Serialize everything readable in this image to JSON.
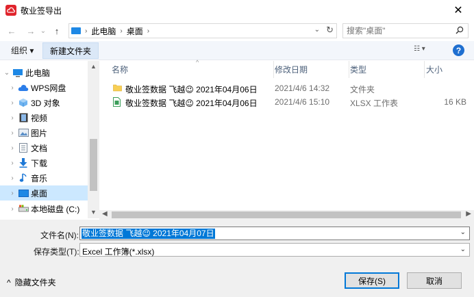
{
  "window": {
    "title": "敬业签导出",
    "close_glyph": "✕"
  },
  "nav": {
    "back_glyph": "←",
    "forward_glyph": "→",
    "history_glyph": "⌄",
    "up_glyph": "↑",
    "breadcrumb": [
      "此电脑",
      "桌面"
    ],
    "crumb_sep": "›",
    "dropdown_glyph": "⌄",
    "refresh_glyph": "↻",
    "search_placeholder": "搜索\"桌面\""
  },
  "toolbar": {
    "organize_label": "组织 ▾",
    "new_folder_label": "新建文件夹",
    "view_glyph": "☷ ▾",
    "help_glyph": "?"
  },
  "sidebar": {
    "items": [
      {
        "label": "此电脑",
        "icon": "computer-icon",
        "chev": "⌄",
        "indent": 0
      },
      {
        "label": "WPS网盘",
        "icon": "cloud-icon",
        "chev": "›",
        "indent": 1
      },
      {
        "label": "3D 对象",
        "icon": "cube-icon",
        "chev": "›",
        "indent": 1
      },
      {
        "label": "视频",
        "icon": "video-icon",
        "chev": "›",
        "indent": 1
      },
      {
        "label": "图片",
        "icon": "picture-icon",
        "chev": "›",
        "indent": 1
      },
      {
        "label": "文档",
        "icon": "document-icon",
        "chev": "›",
        "indent": 1
      },
      {
        "label": "下载",
        "icon": "download-icon",
        "chev": "›",
        "indent": 1
      },
      {
        "label": "音乐",
        "icon": "music-icon",
        "chev": "›",
        "indent": 1
      },
      {
        "label": "桌面",
        "icon": "desktop-icon",
        "chev": "›",
        "indent": 1,
        "selected": true
      },
      {
        "label": "本地磁盘 (C:)",
        "icon": "drive-icon",
        "chev": "›",
        "indent": 1
      }
    ]
  },
  "columns": {
    "name": "名称",
    "modified": "修改日期",
    "type": "类型",
    "size": "大小",
    "sort_glyph": "^"
  },
  "files": [
    {
      "name": "敬业签数据 飞越😉 2021年04月06日",
      "modified": "2021/4/6 14:32",
      "type": "文件夹",
      "size": "",
      "icon": "folder-icon"
    },
    {
      "name": "敬业签数据 飞越😉 2021年04月06日",
      "modified": "2021/4/6 15:10",
      "type": "XLSX 工作表",
      "size": "16 KB",
      "icon": "xlsx-file-icon"
    }
  ],
  "form": {
    "filename_label": "文件名(N):",
    "filename_value": "敬业签数据 飞越😉 2021年04月07日",
    "filetype_label": "保存类型(T):",
    "filetype_value": "Excel 工作簿(*.xlsx)",
    "dropdown_glyph": "⌄"
  },
  "footer": {
    "hide_folders_glyph": "^",
    "hide_folders_label": "隐藏文件夹",
    "save_label": "保存(S)",
    "cancel_label": "取消"
  },
  "scroll": {
    "up": "▲",
    "down": "▼",
    "left": "◀",
    "right": "▶"
  },
  "colors": {
    "accent": "#0078d7",
    "selection": "#cce8ff",
    "app_icon": "#e0242c"
  }
}
